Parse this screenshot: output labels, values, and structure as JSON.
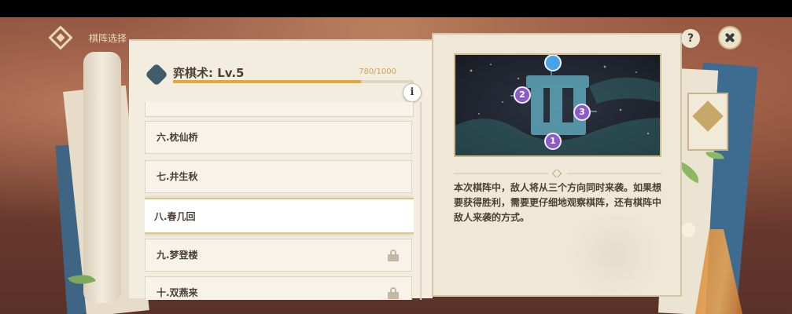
{
  "header": {
    "title": "棋阵选择",
    "logo_icon": "puzzle-emblem-icon"
  },
  "help_button": {
    "label": "?"
  },
  "close_button": {
    "icon": "close-icon"
  },
  "skill": {
    "title": "弈棋术: Lv.5",
    "progress_text": "780/1000",
    "progress_value": 780,
    "progress_max": 1000,
    "info_label": "i"
  },
  "formations": [
    {
      "label": "六.枕仙桥",
      "locked": false,
      "selected": false
    },
    {
      "label": "七.井生秋",
      "locked": false,
      "selected": false
    },
    {
      "label": "八.春几回",
      "locked": false,
      "selected": true
    },
    {
      "label": "九.梦登楼",
      "locked": true,
      "selected": false
    },
    {
      "label": "十.双燕来",
      "locked": true,
      "selected": false
    }
  ],
  "map": {
    "markers": [
      "1",
      "2",
      "3"
    ],
    "colors": {
      "marker_purple": "#8b5cc7",
      "spawn_blue": "#4aa3e8",
      "path": "#6ec6c9"
    }
  },
  "description": "本次棋阵中，敌人将从三个方向同时来袭。如果想要获得胜利，需要更仔细地观察棋阵，还有棋阵中敌人来袭的方式。"
}
